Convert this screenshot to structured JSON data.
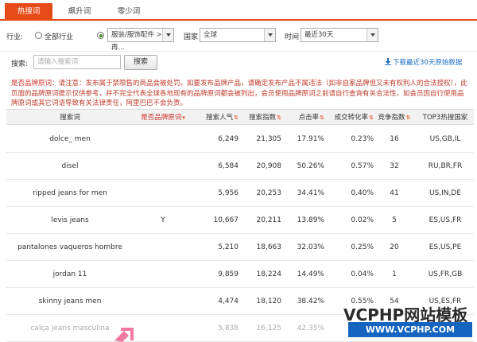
{
  "tabs": [
    {
      "label": "热搜词",
      "active": true
    },
    {
      "label": "飙升词",
      "active": false
    },
    {
      "label": "零少词",
      "active": false
    }
  ],
  "filters": {
    "industry_label": "行业:",
    "radio_all": "全部行业",
    "category_value": "服装/服饰配件 > 再...",
    "country_label": "国家",
    "country_value": "全球",
    "time_label": "时间",
    "time_value": "最近30天"
  },
  "search": {
    "label": "搜索:",
    "placeholder": "请输入搜索词",
    "button": "搜索",
    "download": "下载最近30天原始数据"
  },
  "notice": {
    "highlight": "是否品牌原词",
    "text": "：请注意：发布属于禁限售的商品会被处罚。如要发布品牌产品，请确定发布产品不属违法（如非自家品牌但又未有权利人的合法授权），此页面的品牌原词提示仅供参考，并不完全代表全球各地现有的品牌原词都会被列出，会员使用品牌原词之前请自行查询有关合法性，如会员因自行使用品牌原词或其它词语导致有关法律责任，阿里巴巴不会负责。"
  },
  "table": {
    "headers": {
      "keyword": "搜索词",
      "brand": "是否品牌原词",
      "popularity": "搜索人气",
      "index": "搜索指数",
      "ctr": "点击率",
      "cvr": "成交转化率",
      "competition": "竞争指数",
      "top3": "TOP3热搜国家"
    },
    "rows": [
      {
        "keyword": "dolce_ men",
        "brand": "",
        "popularity": "6,249",
        "index": "21,305",
        "ctr": "17.91%",
        "cvr": "0.23%",
        "competition": "16",
        "top3": "US,GB,IL"
      },
      {
        "keyword": "disel",
        "brand": "",
        "popularity": "6,584",
        "index": "20,908",
        "ctr": "50.26%",
        "cvr": "0.57%",
        "competition": "32",
        "top3": "RU,BR,FR"
      },
      {
        "keyword": "ripped jeans for men",
        "brand": "",
        "popularity": "5,956",
        "index": "20,253",
        "ctr": "34.41%",
        "cvr": "0.40%",
        "competition": "41",
        "top3": "US,IN,DE"
      },
      {
        "keyword": "levis jeans",
        "brand": "Y",
        "popularity": "10,667",
        "index": "20,211",
        "ctr": "13.89%",
        "cvr": "0.02%",
        "competition": "5",
        "top3": "ES,US,FR"
      },
      {
        "keyword": "pantalones vaqueros hombre",
        "brand": "",
        "popularity": "5,210",
        "index": "18,663",
        "ctr": "32.03%",
        "cvr": "0.25%",
        "competition": "20",
        "top3": "ES,US,PE"
      },
      {
        "keyword": "jordan 11",
        "brand": "",
        "popularity": "9,859",
        "index": "18,224",
        "ctr": "14.49%",
        "cvr": "0.04%",
        "competition": "1",
        "top3": "US,FR,GB"
      },
      {
        "keyword": "skinny jeans men",
        "brand": "",
        "popularity": "4,474",
        "index": "18,120",
        "ctr": "38.42%",
        "cvr": "0.55%",
        "competition": "54",
        "top3": "US,ES,FR"
      },
      {
        "keyword": "calça jeans masculina",
        "brand": "",
        "popularity": "5,838",
        "index": "16,125",
        "ctr": "42.35%",
        "cvr": "0.26%",
        "competition": "",
        "top3": ""
      }
    ]
  },
  "watermark": {
    "line1": "VCPHP网站模板",
    "line2": "WWW.VCPHP.COM"
  },
  "colors": {
    "accent": "#e64a19",
    "link": "#1a6fc4",
    "notice": "#c0392b"
  }
}
